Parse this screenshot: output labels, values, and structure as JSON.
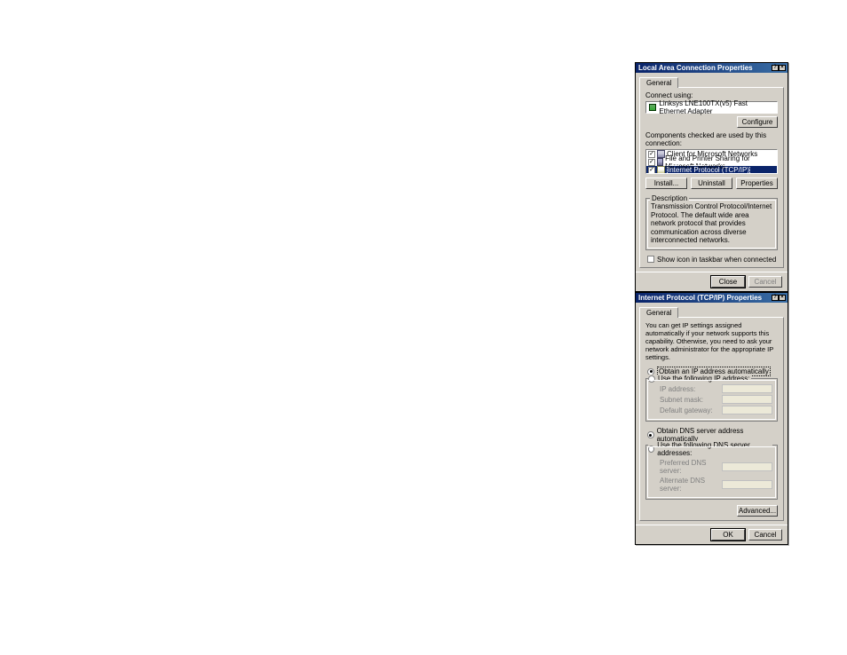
{
  "dialog1": {
    "title": "Local Area Connection Properties",
    "tab": "General",
    "connect_using_label": "Connect using:",
    "adapter_name": "Linksys LNE100TX(v5) Fast Ethernet Adapter",
    "configure_btn": "Configure",
    "components_label": "Components checked are used by this connection:",
    "components": [
      {
        "label": "Client for Microsoft Networks",
        "checked": true
      },
      {
        "label": "File and Printer Sharing for Microsoft Networks",
        "checked": true
      },
      {
        "label": "Internet Protocol (TCP/IP)",
        "checked": true
      }
    ],
    "install_btn": "Install...",
    "uninstall_btn": "Uninstall",
    "properties_btn": "Properties",
    "desc_title": "Description",
    "desc_text": "Transmission Control Protocol/Internet Protocol. The default wide area network protocol that provides communication across diverse interconnected networks.",
    "taskbar_label": "Show icon in taskbar when connected",
    "close_btn": "Close",
    "cancel_btn": "Cancel"
  },
  "dialog2": {
    "title": "Internet Protocol (TCP/IP) Properties",
    "tab": "General",
    "intro_text": "You can get IP settings assigned automatically if your network supports this capability. Otherwise, you need to ask your network administrator for the appropriate IP settings.",
    "radio_auto_ip": "Obtain an IP address automatically",
    "radio_manual_ip": "Use the following IP address:",
    "ip_address_label": "IP address:",
    "subnet_label": "Subnet mask:",
    "gateway_label": "Default gateway:",
    "radio_auto_dns": "Obtain DNS server address automatically",
    "radio_manual_dns": "Use the following DNS server addresses:",
    "preferred_dns_label": "Preferred DNS server:",
    "alternate_dns_label": "Alternate DNS server:",
    "advanced_btn": "Advanced...",
    "ok_btn": "OK",
    "cancel_btn": "Cancel"
  }
}
